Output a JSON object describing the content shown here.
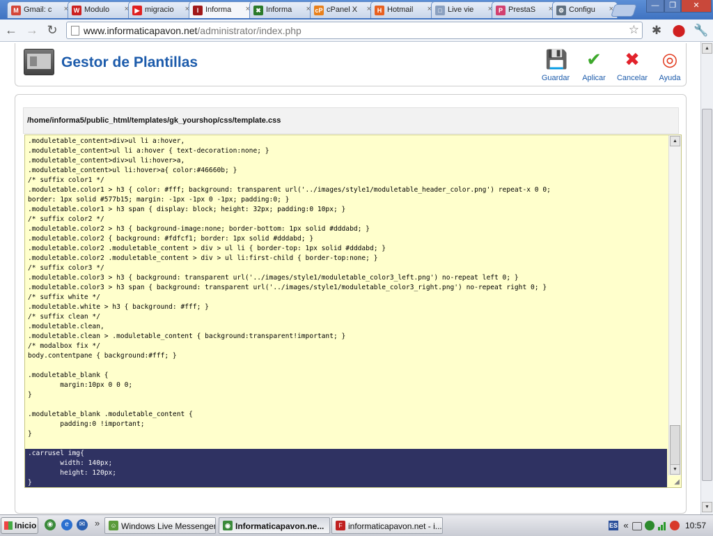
{
  "browser": {
    "tabs": [
      {
        "title": "Gmail: c",
        "icon": "gmail-icon",
        "color": "#d44638",
        "glyph": "M"
      },
      {
        "title": "Modulo",
        "icon": "modulo-site-icon",
        "color": "#cc2020",
        "glyph": "W"
      },
      {
        "title": "migracio",
        "icon": "youtube-icon",
        "color": "#e02020",
        "glyph": "▶"
      },
      {
        "title": "Informa",
        "icon": "joomla-admin-icon",
        "color": "#a01818",
        "glyph": "I"
      },
      {
        "title": "Informa",
        "icon": "joomla-icon",
        "color": "#2a7a2a",
        "glyph": "✖"
      },
      {
        "title": "cPanel X",
        "icon": "cpanel-icon",
        "color": "#e8801c",
        "glyph": "cP"
      },
      {
        "title": "Hotmail",
        "icon": "hotmail-icon",
        "color": "#e86020",
        "glyph": "H"
      },
      {
        "title": "Live vie",
        "icon": "page-icon",
        "color": "#8aa0c0",
        "glyph": "□"
      },
      {
        "title": "PrestaS",
        "icon": "prestashop-icon",
        "color": "#d24070",
        "glyph": "P"
      },
      {
        "title": "Configu",
        "icon": "wrench-icon",
        "color": "#607080",
        "glyph": "⚙"
      }
    ],
    "tab_close_glyph": "×",
    "window_buttons": {
      "minimize": "—",
      "maximize": "❐",
      "close": "✕"
    },
    "nav": {
      "back": "←",
      "forward": "→",
      "reload": "↻"
    },
    "url_host": "www.informaticapavon.net",
    "url_path": "/administrator/index.php",
    "star": "☆",
    "toolbar_icons": {
      "extension": "✱",
      "stop": "⬤",
      "wrench": "🔧"
    }
  },
  "header": {
    "title": "Gestor de Plantillas",
    "buttons": [
      {
        "label": "Guardar",
        "icon": "save-icon",
        "glyph": "💾",
        "color": "#222222"
      },
      {
        "label": "Aplicar",
        "icon": "apply-check-icon",
        "glyph": "✔",
        "color": "#3da82b"
      },
      {
        "label": "Cancelar",
        "icon": "cancel-icon",
        "glyph": "✖",
        "color": "#e2222b"
      },
      {
        "label": "Ayuda",
        "icon": "help-lifebuoy-icon",
        "glyph": "◎",
        "color": "#e23a1e"
      }
    ]
  },
  "editor": {
    "file_path": "/home/informa5/public_html/templates/gk_yourshop/css/template.css",
    "lines": [
      ".moduletable_content>div>ul li a:hover,",
      ".moduletable_content>ul li a:hover { text-decoration:none; }",
      ".moduletable_content>div>ul li:hover>a,",
      ".moduletable_content>ul li:hover>a{ color:#46660b; }",
      "/* suffix color1 */",
      ".moduletable.color1 > h3 { color: #fff; background: transparent url('../images/style1/moduletable_header_color.png') repeat-x 0 0;",
      "border: 1px solid #577b15; margin: -1px -1px 0 -1px; padding:0; }",
      ".moduletable.color1 > h3 span { display: block; height: 32px; padding:0 10px; }",
      "/* suffix color2 */",
      ".moduletable.color2 > h3 { background-image:none; border-bottom: 1px solid #dddabd; }",
      ".moduletable.color2 { background: #fdfcf1; border: 1px solid #dddabd; }",
      ".moduletable.color2 .moduletable_content > div > ul li { border-top: 1px solid #dddabd; }",
      ".moduletable.color2 .moduletable_content > div > ul li:first-child { border-top:none; }",
      "/* suffix color3 */",
      ".moduletable.color3 > h3 { background: transparent url('../images/style1/moduletable_color3_left.png') no-repeat left 0; }",
      ".moduletable.color3 > h3 span { background: transparent url('../images/style1/moduletable_color3_right.png') no-repeat right 0; }",
      "/* suffix white */",
      ".moduletable.white > h3 { background: #fff; }",
      "/* suffix clean */",
      ".moduletable.clean,",
      ".moduletable.clean > .moduletable_content { background:transparent!important; }",
      "/* modalbox fix */",
      "body.contentpane { background:#fff; }",
      "",
      ".moduletable_blank {",
      "        margin:10px 0 0 0;",
      "}",
      "",
      ".moduletable_blank .moduletable_content {",
      "        padding:0 !important;",
      "}",
      "",
      ".carrusel img{",
      "        width: 140px;",
      "        height: 120px;",
      "}"
    ],
    "selected_from": 32,
    "scroll_up": "▲",
    "scroll_down": "▼",
    "resize_grip": "◢"
  },
  "taskbar": {
    "start_label": "Inicio",
    "quicklaunch": [
      {
        "icon": "chrome-icon",
        "color": "#3a8a3a",
        "glyph": "◉"
      },
      {
        "icon": "ie-icon",
        "color": "#2a6fd0",
        "glyph": "e"
      },
      {
        "icon": "outlook-icon",
        "color": "#2a5fb0",
        "glyph": "✉"
      }
    ],
    "overflow": "»",
    "tasks": [
      {
        "label": "Windows Live Messenger",
        "icon": "messenger-icon",
        "color": "#5a9a3a",
        "glyph": "☺",
        "active": false
      },
      {
        "label": "Informaticapavon.ne...",
        "icon": "chrome-icon",
        "color": "#3a8a3a",
        "glyph": "◉",
        "active": true
      },
      {
        "label": "informaticapavon.net - i...",
        "icon": "filezilla-icon",
        "color": "#c02020",
        "glyph": "F",
        "active": false
      }
    ],
    "lang": "ES",
    "tray_chevron": "«",
    "clock": "10:57"
  }
}
